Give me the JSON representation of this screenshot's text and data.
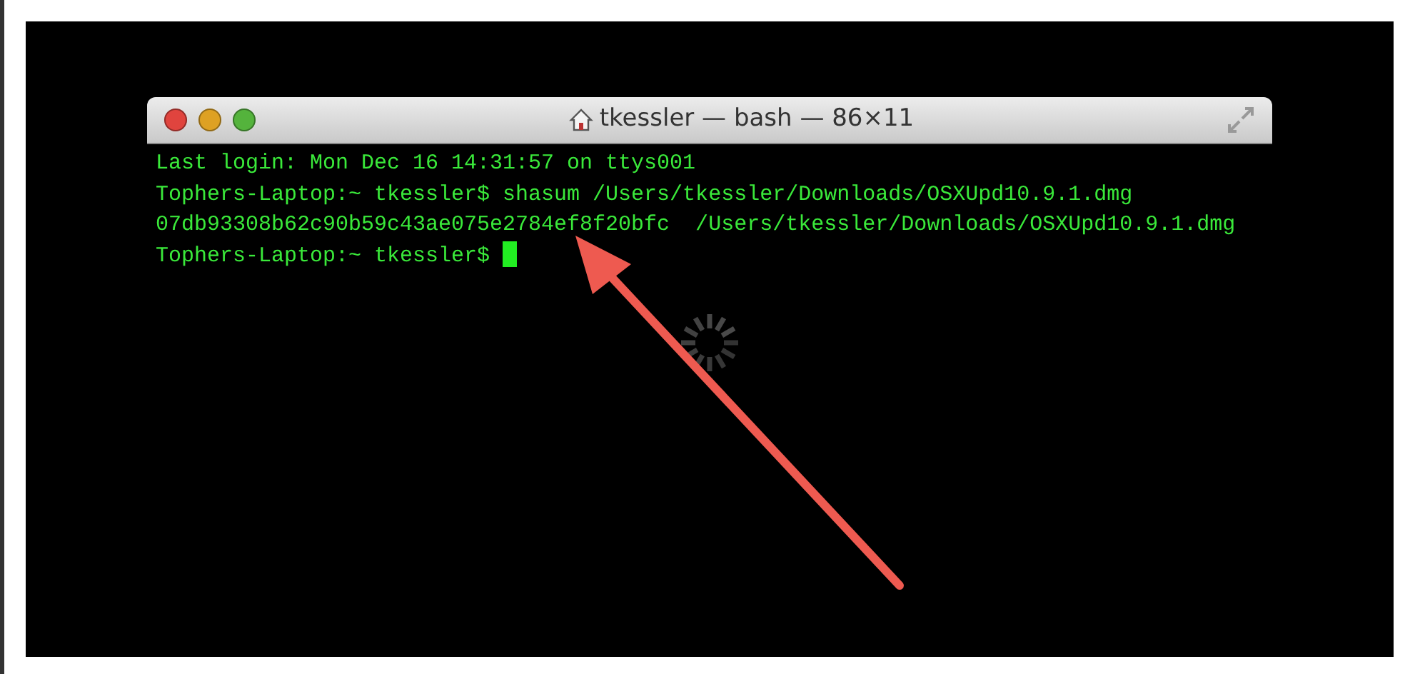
{
  "window": {
    "title": "tkessler — bash — 86×11",
    "buttons": [
      {
        "color": "#e0443e"
      },
      {
        "color": "#dea123"
      },
      {
        "color": "#54b33c"
      }
    ]
  },
  "lines": [
    {
      "text": "Last login: Mon Dec 16 14:31:57 on ttys001",
      "cursor": false
    },
    {
      "text": "Tophers-Laptop:~ tkessler$ shasum /Users/tkessler/Downloads/OSXUpd10.9.1.dmg",
      "cursor": false
    },
    {
      "text": "07db93308b62c90b59c43ae075e2784ef8f20bfc  /Users/tkessler/Downloads/OSXUpd10.9.1.dmg",
      "cursor": false
    },
    {
      "text": "Tophers-Laptop:~ tkessler$ ",
      "cursor": true
    }
  ]
}
